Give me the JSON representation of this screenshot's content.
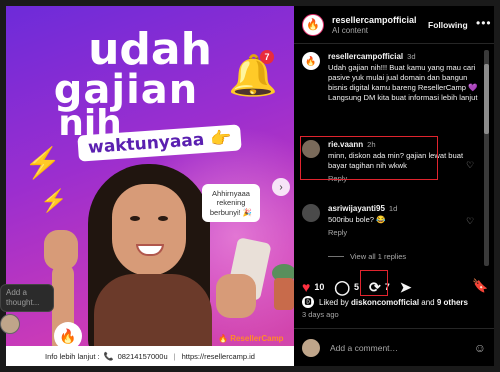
{
  "post_image": {
    "headline": [
      "udah",
      "gajian",
      "nih"
    ],
    "pill": "waktunyaaa 👉",
    "bell_badge": "7",
    "speech": "Ahhirnyaaa rekening berbunyi! 🎉",
    "footer": {
      "lead": "Info lebih lanjut :",
      "phone": "08214157000u",
      "url": "https://resellercamp.id"
    },
    "brand_mark": "ResellerCamp",
    "thought_placeholder": "Add a thought..."
  },
  "header": {
    "username": "resellercampofficial",
    "subtitle": "AI content",
    "follow_label": "Following",
    "more_label": "•••"
  },
  "caption": {
    "username": "resellercampofficial",
    "time": "3d",
    "text": "Udah gajian nih!!! Buat kamu yang mau cari pasive yuk mulai jual domain dan bangun bisnis digital kamu bareng ResellerCamp 💜 Langsung DM kita buat informasi lebih lanjut"
  },
  "comments": [
    {
      "username": "rie.vaann",
      "time": "2h",
      "text": "minn, diskon ada min? gajian lewat buat bayar tagihan nih wkwk",
      "reply_label": "Reply",
      "avatar_color": "#7a6a5a"
    },
    {
      "username": "asriwijayanti95",
      "time": "1d",
      "text": "500ribu bole? 😂",
      "reply_label": "Reply",
      "avatar_color": "#4a4a4a"
    }
  ],
  "view_replies": "View all 1 replies",
  "actions": {
    "likes": "10",
    "comments": "5",
    "reposts": "7"
  },
  "liked_by": {
    "prefix": "Liked by",
    "user": "diskoncomofficial",
    "join": "and",
    "others": "9 others"
  },
  "posted_ago": "3 days ago",
  "add_comment_placeholder": "Add a comment…",
  "colors": {
    "highlight": "#e0242e",
    "like": "#ff3040",
    "panel_bg": "#000000"
  }
}
